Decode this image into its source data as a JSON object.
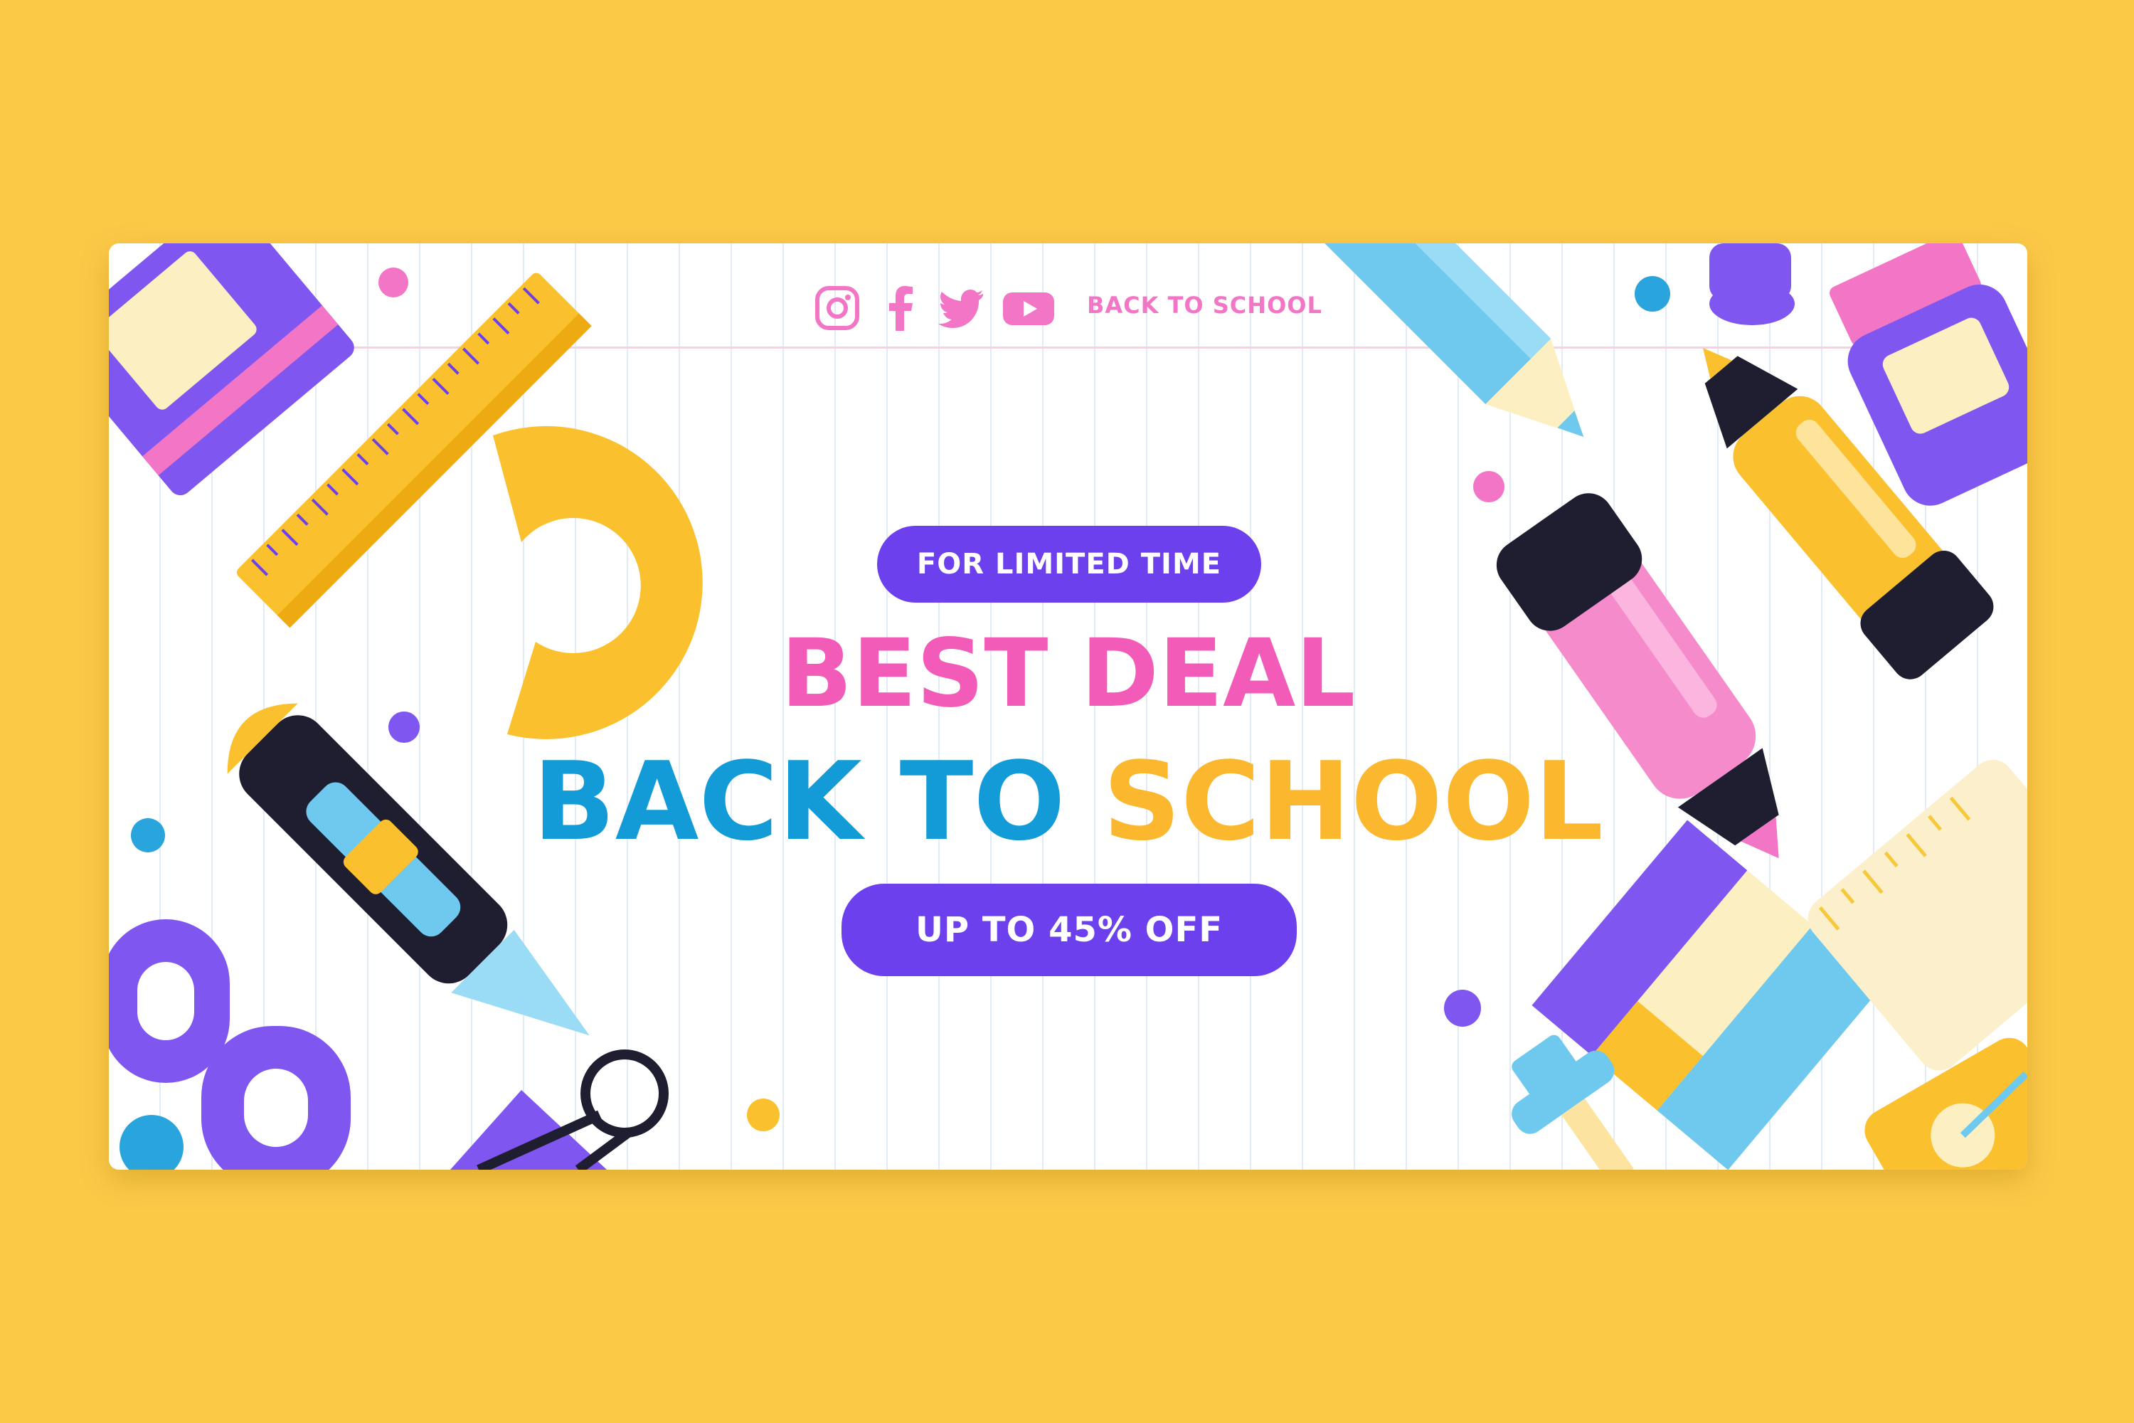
{
  "header": {
    "label": "BACK TO SCHOOL",
    "icons": [
      "instagram-icon",
      "facebook-icon",
      "twitter-icon",
      "youtube-icon"
    ]
  },
  "promo": {
    "tag": "FOR LIMITED TIME",
    "headline_1": "BEST DEAL",
    "headline_2a": "BACK TO",
    "headline_2b": "SCHOOL",
    "offer": "UP TO 45% OFF"
  },
  "colors": {
    "background": "#FCC947",
    "panel": "#FFFFFF",
    "accent_purple": "#6D40EE",
    "pink": "#F25BB8",
    "blue": "#139BD8",
    "yellow": "#FBB72D"
  }
}
